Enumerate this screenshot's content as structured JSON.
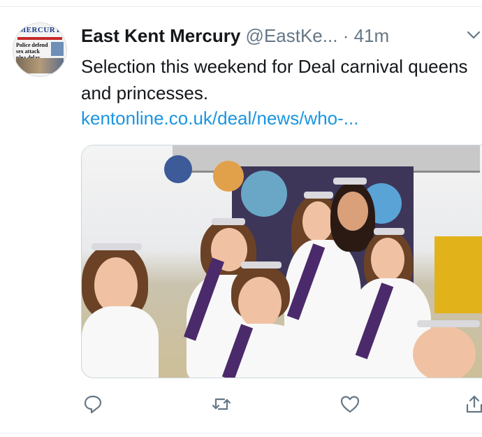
{
  "tweet": {
    "author_name": "East Kent Mercury",
    "handle": "@EastKe...",
    "separator": "·",
    "time": "41m",
    "text": "Selection this weekend for Deal carnival queens and princesses.",
    "link": "kentonline.co.uk/deal/news/who-..."
  },
  "avatar": {
    "masthead": "MERCURY",
    "headline": "Police defend sex attack plea delay"
  },
  "icons": {
    "chevron": "chevron-down-icon",
    "reply": "reply-icon",
    "retweet": "retweet-icon",
    "like": "heart-icon",
    "share": "share-icon"
  },
  "colors": {
    "link": "#1b95e0",
    "secondary_text": "#657786",
    "icon": "#657786",
    "divider": "#e6ecf0"
  }
}
